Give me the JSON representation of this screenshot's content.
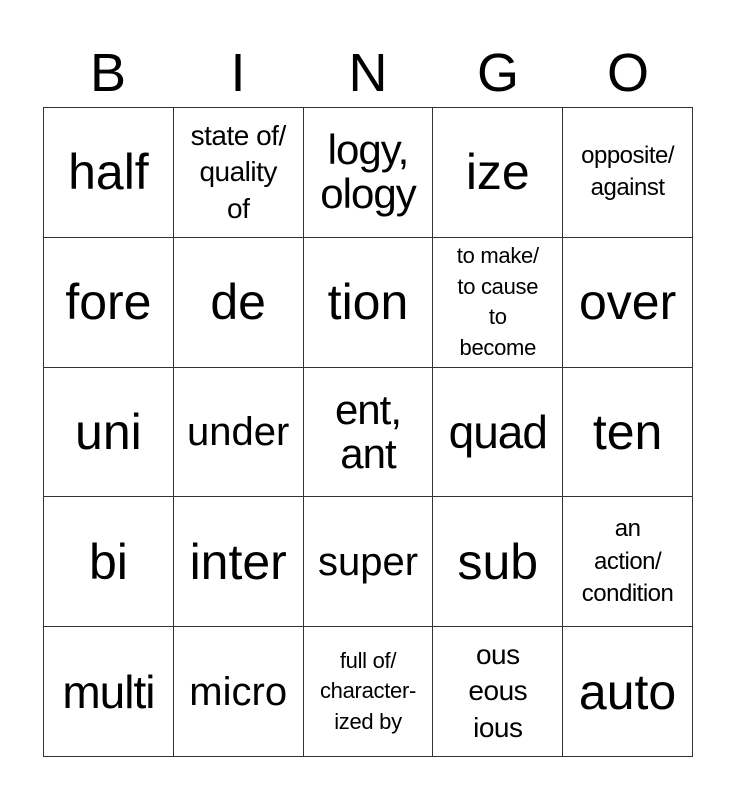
{
  "title_letters": [
    "B",
    "I",
    "N",
    "G",
    "O"
  ],
  "grid": [
    [
      "half",
      "state of/\nquality\nof",
      "logy,\nology",
      "ize",
      "opposite/\nagainst"
    ],
    [
      "fore",
      "de",
      "tion",
      "to make/\nto cause\nto\nbecome",
      "over"
    ],
    [
      "uni",
      "under",
      "ent,\nant",
      "quad",
      "ten"
    ],
    [
      "bi",
      "inter",
      "super",
      "sub",
      "an\naction/\ncondition"
    ],
    [
      "multi",
      "micro",
      "full of/\ncharacter-\nized by",
      "ous\neous\nious",
      "auto"
    ]
  ]
}
